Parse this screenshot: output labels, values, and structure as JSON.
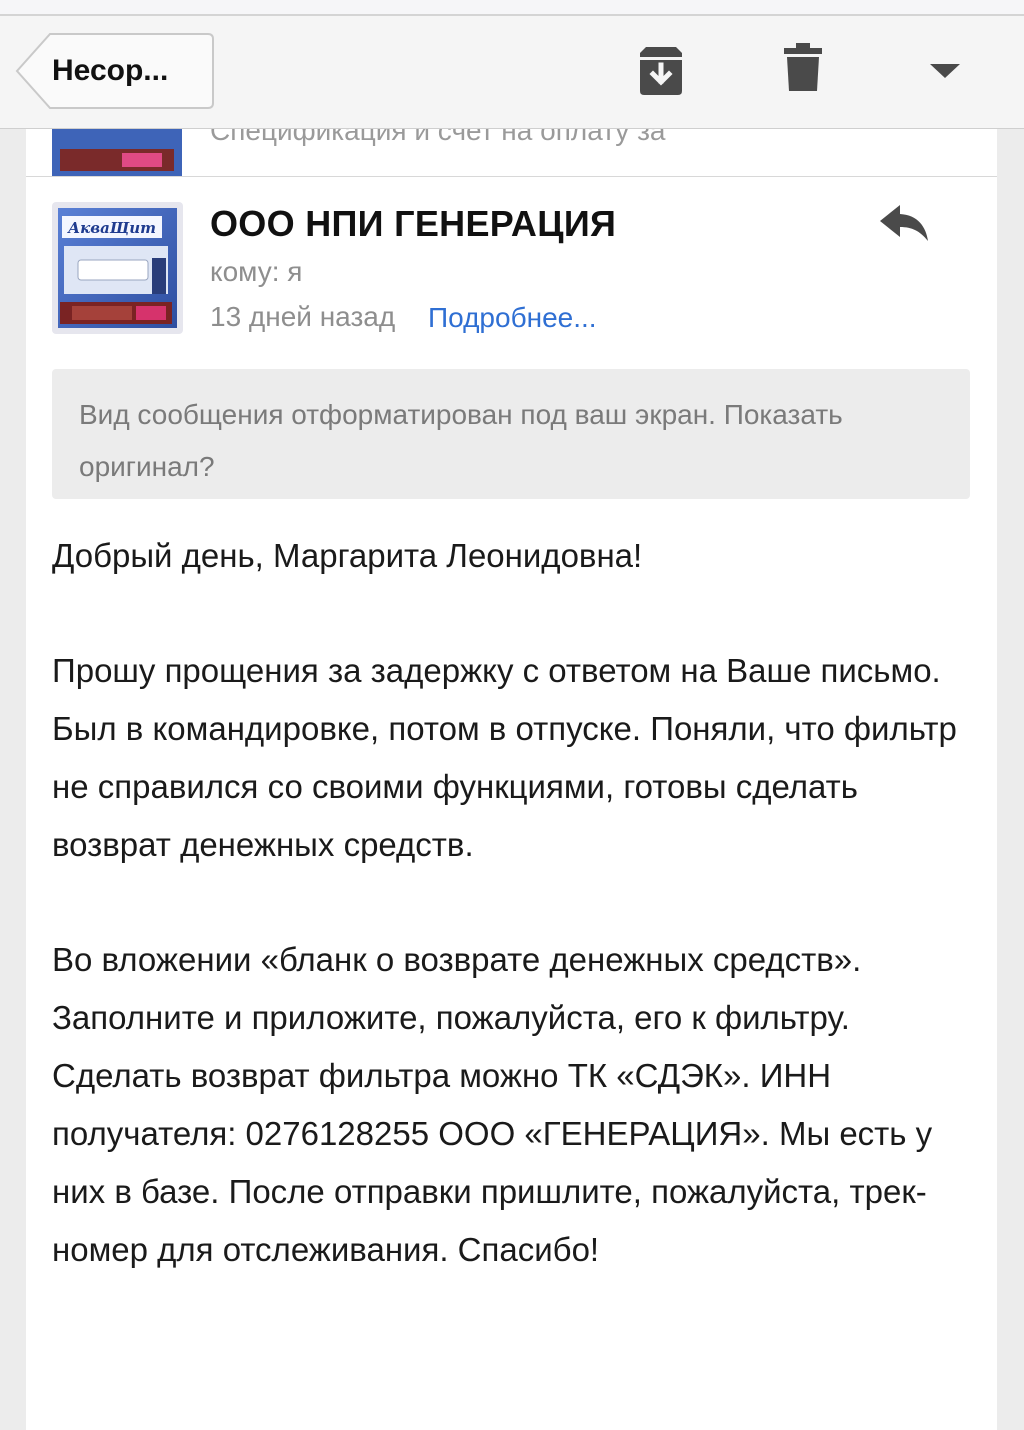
{
  "toolbar": {
    "back_label": "Несор...",
    "icons": [
      "archive-icon",
      "trash-icon",
      "chevron-down-icon"
    ]
  },
  "previous_message": {
    "subject_preview": "Спецификация и счет на оплату за"
  },
  "message": {
    "sender": "ООО НПИ ГЕНЕРАЦИЯ",
    "to_line": "кому: я",
    "date": "13 дней назад",
    "details_link": "Подробнее...",
    "avatar_brand": "АкваЩит",
    "notice": "Вид сообщения отформатирован под ваш экран. Показать оригинал?",
    "body": [
      "Добрый день, Маргарита Леонидовна!",
      "Прошу прощения за задержку с ответом на Ваше письмо. Был в командировке, потом в отпуске. Поняли, что фильтр не справился со своими функциями, готовы сделать возврат денежных средств.",
      "Во вложении «бланк о возврате денежных средств». Заполните и приложите, пожалуйста, его к фильтру. Сделать возврат фильтра можно ТК «СДЭК». ИНН получателя: 0276128255 ООО «ГЕНЕРАЦИЯ». Мы есть у них в базе. После отправки пришлите, пожалуйста, трек-номер для отслеживания. Спасибо!"
    ]
  },
  "colors": {
    "link": "#2f6fd3",
    "icon_gray": "#4a4a4a",
    "notice_bg": "#ececec",
    "avatar_accent": "#d6336c"
  }
}
